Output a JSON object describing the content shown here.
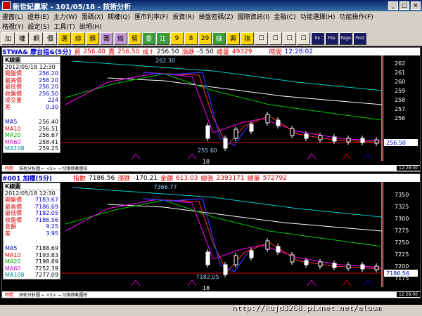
{
  "window": {
    "title": "新世紀贏家 - 101/05/18 - 技術分析"
  },
  "menu": {
    "row1": [
      "畫面(L)",
      "證券(E)",
      "主力(W)",
      "籌碼(X)",
      "期權(Q)",
      "匯市利率(F)",
      "投資(R)",
      "操盤密碼(Z)",
      "國際資訊(I)",
      "金融(C)",
      "功能選擇(H)",
      "功能操作(F)"
    ],
    "row2": [
      "格視(Y)",
      "設定(S)",
      "工具(T)",
      "說明(H)"
    ]
  },
  "toolbar": {
    "buttons": [
      "加",
      "權",
      "期",
      "價",
      "選",
      "綜",
      "類",
      "籌",
      "線",
      "留",
      "委",
      "江",
      "9",
      "8",
      "29",
      "綠",
      "興",
      "指",
      "☐",
      "☐",
      "☐",
      "☐",
      "Ex",
      "File",
      "Page",
      "Find"
    ]
  },
  "panel1": {
    "header": {
      "symbol": "STWA& 摩台指&(5分)",
      "bid_label": "買",
      "bid": "256.40",
      "ask_label": "賣",
      "ask": "256.50",
      "last_label": "成↑",
      "last": "256.50",
      "chg_label": "漲跌",
      "chg": "-5.50",
      "vol_label": "總量",
      "vol": "49329",
      "time_label": "時間",
      "time": "12:28:02"
    },
    "info": {
      "title": "K線圖",
      "date": "2012/05/18 12:30",
      "rows": [
        [
          "開盤價",
          "256.20"
        ],
        [
          "最高價",
          "256.20"
        ],
        [
          "最低價",
          "256.20"
        ],
        [
          "收盤價",
          "256.50"
        ],
        [
          "成交量",
          "224"
        ],
        [
          "差",
          "0.30"
        ]
      ],
      "ma": [
        [
          "MA5",
          "256.40"
        ],
        [
          "MA10",
          "256.51"
        ],
        [
          "MA20",
          "256.67"
        ],
        [
          "MA60",
          "258.41"
        ],
        [
          "MA108",
          "259.25"
        ]
      ]
    },
    "yticks": [
      "262",
      "261",
      "260",
      "259",
      "258",
      "257",
      "256"
    ],
    "last_price_tag": "256.50",
    "high_label": "262.30",
    "low_label": "255.60",
    "xlabel": "18",
    "footer_left": "時間",
    "footer_mid": "技術分析圖 ← <5> → 切換移動圖形",
    "footer_time": "12:28:00"
  },
  "panel2": {
    "header": {
      "symbol": "#001 加權(5分)",
      "idx_label": "指數",
      "idx": "7186.56",
      "chg_label": "漲跌",
      "chg": "-170.21",
      "amt_label": "金額",
      "amt": "613.03",
      "vol_label": "總張",
      "vol": "2393171",
      "cnt_label": "總筆",
      "cnt": "572792"
    },
    "info": {
      "title": "K線圖",
      "date": "2012/05/18 12:30",
      "rows": [
        [
          "開盤價",
          "7183.67"
        ],
        [
          "最高價",
          "7186.69"
        ],
        [
          "最低價",
          "7182.05"
        ],
        [
          "收盤價",
          "7186.56"
        ],
        [
          "金額",
          "9.25"
        ],
        [
          "差",
          "3.95"
        ]
      ],
      "ma": [
        [
          "MA5",
          "7188.69"
        ],
        [
          "MA10",
          "7193.83"
        ],
        [
          "MA20",
          "7198.89"
        ],
        [
          "MA60",
          "7252.39"
        ],
        [
          "MA108",
          "7277.09"
        ]
      ]
    },
    "yticks": [
      "7350",
      "7325",
      "7300",
      "7275",
      "7250",
      "7225",
      "7200",
      "7175"
    ],
    "last_price_tag": "7186.56",
    "high_label": "7366.77",
    "low_label": "7182.05",
    "xlabel": "18",
    "footer_left": "時間",
    "footer_mid": "技術分析圖 ← <5> → 切換移動圖形",
    "footer_time": "12:28:00"
  },
  "watermark": "http://kujd3268.pixnet.net/album"
}
